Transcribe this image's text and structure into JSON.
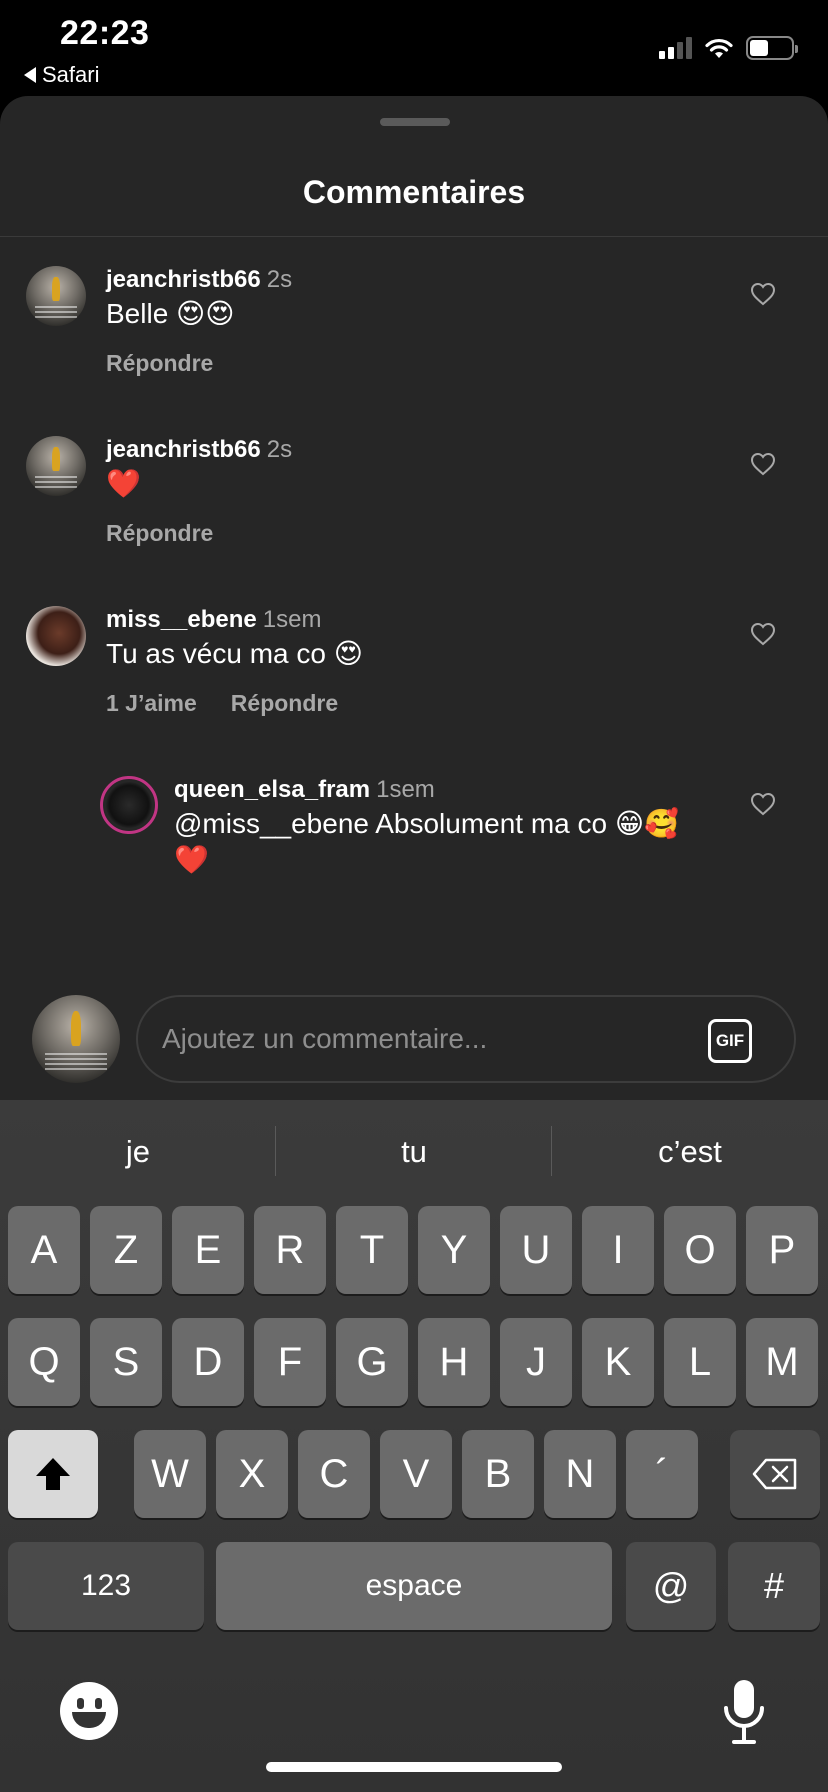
{
  "status_bar": {
    "time": "22:23",
    "back_app": "Safari",
    "battery_level": 0.45
  },
  "sheet": {
    "title": "Commentaires"
  },
  "comments": [
    {
      "user": "jeanchristb66",
      "time": "2s",
      "text": "Belle 😍😍",
      "actions": {
        "reply": "Répondre"
      }
    },
    {
      "user": "jeanchristb66",
      "time": "2s",
      "text": "❤️",
      "actions": {
        "reply": "Répondre"
      }
    },
    {
      "user": "miss__ebene",
      "time": "1sem",
      "text": "Tu as vécu ma co 😍",
      "actions": {
        "likes": "1 J’aime",
        "reply": "Répondre"
      }
    },
    {
      "user": "queen_elsa_fram",
      "time": "1sem",
      "text": "@miss__ebene Absolument ma co 😁🥰",
      "text_line2": "❤️"
    }
  ],
  "quick_reactions": [
    "❤️",
    "🙌",
    "🔥",
    "👏",
    "😢",
    "😍",
    "😮",
    "😂"
  ],
  "composer": {
    "placeholder": "Ajoutez un commentaire...",
    "gif_label": "GIF"
  },
  "keyboard": {
    "suggestions": [
      "je",
      "tu",
      "c’est"
    ],
    "row1": [
      "A",
      "Z",
      "E",
      "R",
      "T",
      "Y",
      "U",
      "I",
      "O",
      "P"
    ],
    "row2": [
      "Q",
      "S",
      "D",
      "F",
      "G",
      "H",
      "J",
      "K",
      "L",
      "M"
    ],
    "row3": [
      "W",
      "X",
      "C",
      "V",
      "B",
      "N",
      "´"
    ],
    "numbers_key": "123",
    "space_key": "espace",
    "at_key": "@",
    "hash_key": "#"
  }
}
